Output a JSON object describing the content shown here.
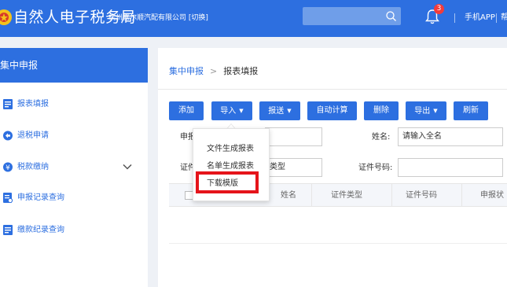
{
  "header": {
    "title": "自然人电子税务局",
    "company": "杭州嘉尔顺汽配有限公司 [切换]",
    "notification_count": "3",
    "links": [
      "手机APP",
      "帮"
    ]
  },
  "sidebar": {
    "title": "集中申报",
    "items": [
      {
        "label": "报表填报",
        "icon": "report-icon"
      },
      {
        "label": "退税申请",
        "icon": "refund-icon"
      },
      {
        "label": "税款缴纳",
        "icon": "payment-icon"
      },
      {
        "label": "申报记录查询",
        "icon": "record-icon"
      },
      {
        "label": "缴款纪录查询",
        "icon": "receipt-icon"
      }
    ]
  },
  "breadcrumb": {
    "root": "集中申报",
    "sep": ">",
    "current": "报表填报"
  },
  "toolbar": {
    "add": "添加",
    "import": "导入",
    "submit": "报送",
    "auto_calc": "自动计算",
    "delete": "删除",
    "export": "导出",
    "refresh": "刷新"
  },
  "filters": {
    "declare_label": "申报",
    "name_label": "姓名:",
    "name_placeholder": "请输入全名",
    "cert_label": "证件",
    "cert_type_value": "类型",
    "cert_no_label": "证件号码:"
  },
  "table": {
    "columns": [
      "姓名",
      "证件类型",
      "证件号码",
      "申报状"
    ]
  },
  "import_menu": {
    "items": [
      "文件生成报表",
      "名单生成报表",
      "下载模版"
    ],
    "highlighted": "下载模版"
  },
  "colors": {
    "primary": "#2d6fe0",
    "highlight": "#e5141a",
    "badge": "#f23b3b"
  }
}
